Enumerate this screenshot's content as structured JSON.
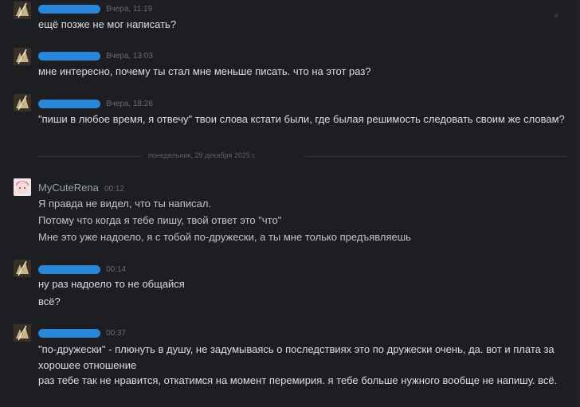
{
  "separator": "понедельник, 29 декабря 2025 г.",
  "groups": [
    {
      "name": "",
      "time": "Вчера, 11:19",
      "lines": [
        "ещё позже не мог написать?"
      ]
    },
    {
      "name": "",
      "time": "Вчера, 13:03",
      "lines": [
        "мне интересно, почему ты стал мне меньше писать. что на этот раз?"
      ]
    },
    {
      "name": "",
      "time": "Вчера, 18:26",
      "lines": [
        "\"пиши в любое время, я отвечу\" твои слова кстати были, где былая решимость следовать своим же словам?"
      ]
    },
    {
      "name": "MyCuteRena",
      "time": "00:12",
      "lines": [
        "Я правда не видел, что ты написал.",
        "Потому что когда я тебе пишу, твой ответ это \"что\"",
        "Мне это уже надоело, я с тобой по-дружески, а ты мне только предъявляешь"
      ]
    },
    {
      "name": "",
      "time": "00:14",
      "lines": [
        "ну раз надоело то не общайся",
        "всё?"
      ]
    },
    {
      "name": "",
      "time": "00:37",
      "lines": [
        "\"по-дружески\" - плюнуть в душу, не задумываясь о последствиях это по дружески очень, да. вот и плата за хорошее отношение",
        "раз тебе так не нравится, откатимся на момент перемирия. я тебе больше нужного вообще не напишу. всё."
      ]
    }
  ],
  "colors": {
    "background": "#1d1e21",
    "text": "#dcdedf",
    "muted": "#686c73",
    "redaction": "#2a86d8"
  }
}
